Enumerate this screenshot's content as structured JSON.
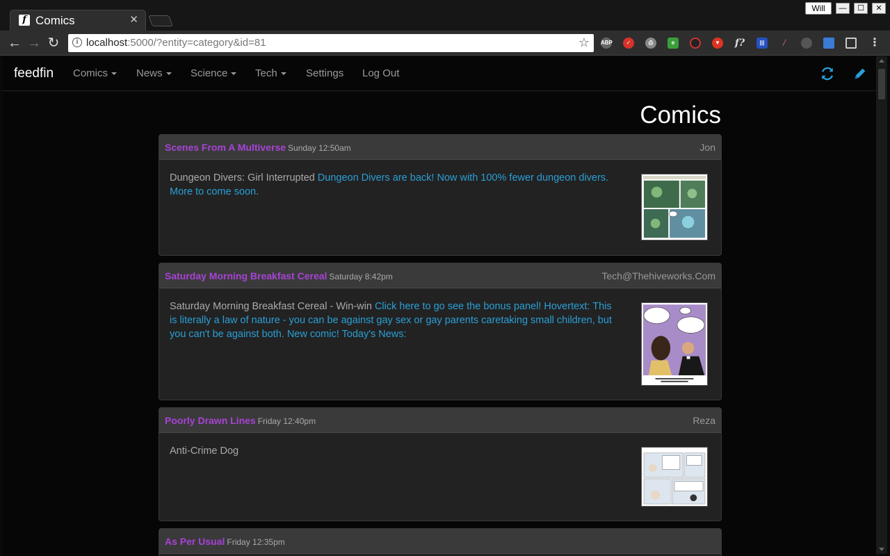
{
  "browser": {
    "tab_title": "Comics",
    "favicon_letter": "f",
    "user_name": "Will",
    "url_host": "localhost",
    "url_rest": ":5000/?entity=category&id=81",
    "extensions": [
      "abp-icon",
      "pocket-icon",
      "print-icon",
      "evernote-icon",
      "opera-icon",
      "vivaldi-icon",
      "feed-icon",
      "tracker-icon",
      "brush-icon",
      "mouse-icon",
      "screenshot-icon",
      "fullscreen-icon",
      "menu-icon"
    ]
  },
  "navbar": {
    "brand": "feedfin",
    "menus": [
      {
        "label": "Comics",
        "dropdown": true
      },
      {
        "label": "News",
        "dropdown": true
      },
      {
        "label": "Science",
        "dropdown": true
      },
      {
        "label": "Tech",
        "dropdown": true
      },
      {
        "label": "Settings",
        "dropdown": false
      },
      {
        "label": "Log Out",
        "dropdown": false
      }
    ],
    "actions": [
      "refresh-icon",
      "edit-icon"
    ]
  },
  "page": {
    "title": "Comics"
  },
  "entries": [
    {
      "feed": "Scenes From A Multiverse",
      "time": "Sunday 12:50am",
      "author": "Jon",
      "text": "Dungeon Divers: Girl Interrupted",
      "link_text": "Dungeon Divers are back! Now with 100% fewer dungeon divers. More to come soon."
    },
    {
      "feed": "Saturday Morning Breakfast Cereal",
      "time": "Saturday 8:42pm",
      "author": "Tech@Thehiveworks.Com",
      "text": "Saturday Morning Breakfast Cereal - Win-win",
      "link_text": "Click here to go see the bonus panel! Hovertext: This is literally a law of nature - you can be against gay sex or gay parents caretaking small children, but you can't be against both. New comic! Today's News:"
    },
    {
      "feed": "Poorly Drawn Lines",
      "time": "Friday 12:40pm",
      "author": "Reza",
      "text": "Anti-Crime Dog",
      "link_text": ""
    },
    {
      "feed": "As Per Usual",
      "time": "Friday 12:35pm",
      "author": "",
      "text": "",
      "link_text": ""
    }
  ],
  "colors": {
    "accent": "#2a9fd6",
    "feed_name": "#a843d6",
    "background": "#060606",
    "card": "#222222",
    "card_header": "#3a3a3a"
  }
}
